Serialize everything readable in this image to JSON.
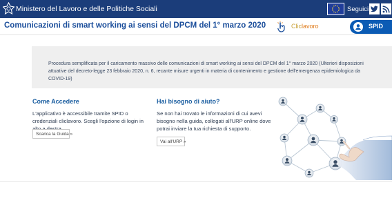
{
  "header": {
    "ministry_name": "Ministero del Lavoro e delle Politiche Sociali",
    "follow_label": "Seguici su:",
    "social": [
      "twitter-icon",
      "rss-icon"
    ]
  },
  "titlebar": {
    "title": "Comunicazioni di smart working ai sensi del DPCM del 1° marzo 2020",
    "partner_prefix": "Clic",
    "partner_suffix": "lavoro",
    "spid_label": "SPID"
  },
  "info": {
    "text": "Procedura semplificata per il caricamento massivo delle comunicazioni di smart working ai sensi del DPCM del 1° marzo 2020 (Ulteriori disposizioni attuative del decreto-legge 23 febbraio 2020, n. 6, recante misure urgenti in materia di contenimento e gestione dell'emergenza epidemiologica da COVID-19)"
  },
  "access": {
    "title": "Come Accedere",
    "text": "L'applicativo è accessibile tramite SPID o credenziali cliclavoro. Scegli l'opzione di login in alto a destra.",
    "button": "Scarica la Guida »"
  },
  "help": {
    "title": "Hai bisogno di aiuto?",
    "text": "Se non hai trovato le informazioni di cui avevi bisogno nella guida, collegati all'URP online dove potrai inviare la tua richiesta di supporto.",
    "button": "Vai all'URP »"
  },
  "colors": {
    "topbar": "#1b3d7a",
    "title": "#1b4e9b",
    "spid": "#0b5bb4",
    "info_bg": "#efefef",
    "link": "#1b5ea0"
  }
}
